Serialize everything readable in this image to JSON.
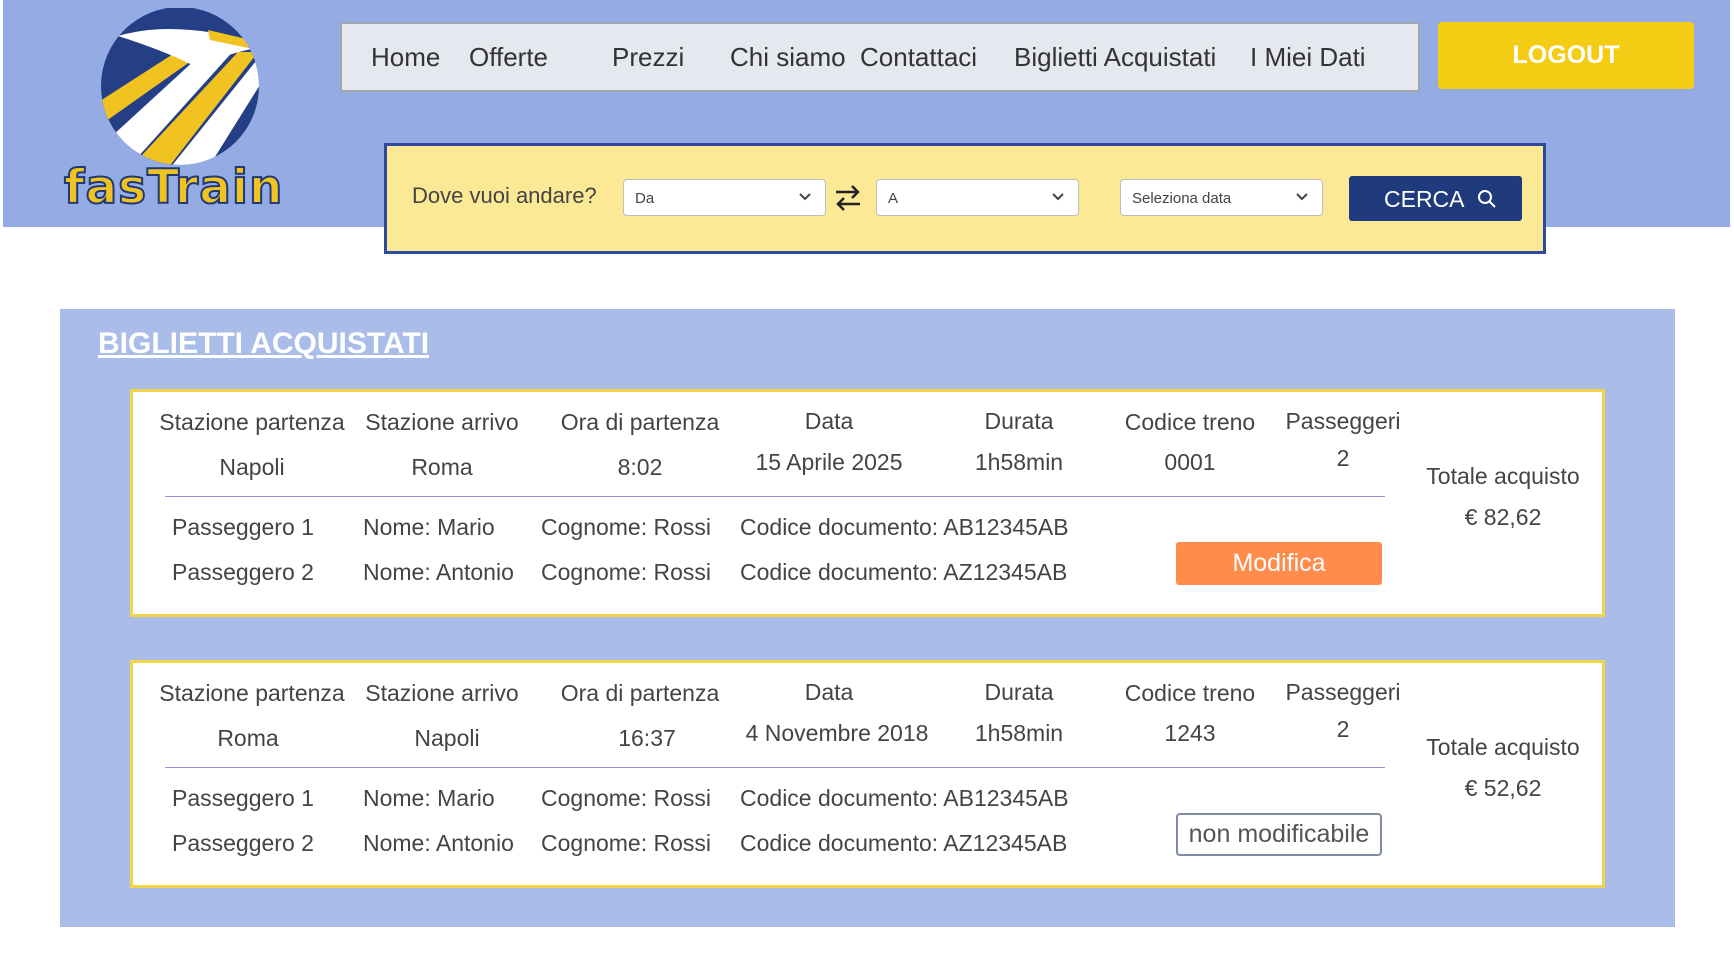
{
  "brand": {
    "name": "fasTrain",
    "colors": {
      "header_bg": "#94abe4",
      "accent": "#f5cc14",
      "navy": "#203a7e",
      "orange": "#ff8c4a"
    }
  },
  "nav": [
    "Home",
    "Offerte",
    "Prezzi",
    "Chi siamo",
    "Contattaci",
    "Biglietti Acquistati",
    "I Miei Dati"
  ],
  "logout_label": "LOGOUT",
  "search": {
    "label": "Dove vuoi andare?",
    "from_placeholder": "Da",
    "to_placeholder": "A",
    "date_placeholder": "Seleziona data",
    "button_label": "CERCA",
    "icons": [
      "chevron-down-icon",
      "swap-icon",
      "search-icon"
    ]
  },
  "section_title": "BIGLIETTI ACQUISTATI",
  "tickets": [
    {
      "headers": [
        "Stazione partenza",
        "Stazione arrivo",
        "Ora di partenza",
        "Data",
        "Durata",
        "Codice treno",
        "Passeggeri"
      ],
      "values": [
        "Napoli",
        "Roma",
        "8:02",
        "15 Aprile 2025",
        "1h58min",
        "0001",
        "2"
      ],
      "total_label": "Totale acquisto",
      "total_value": "€ 82,62",
      "passengers": [
        {
          "label": "Passeggero 1",
          "nome": "Nome: Mario",
          "cognome": "Cognome: Rossi",
          "documento": "Codice documento: AB12345AB"
        },
        {
          "label": "Passeggero 2",
          "nome": "Nome: Antonio",
          "cognome": "Cognome: Rossi",
          "documento": "Codice documento: AZ12345AB"
        }
      ],
      "action_label": "Modifica"
    },
    {
      "headers": [
        "Stazione partenza",
        "Stazione arrivo",
        "Ora di partenza",
        "Data",
        "Durata",
        "Codice treno",
        "Passeggeri"
      ],
      "values": [
        "Roma",
        "Napoli",
        "16:37",
        "4 Novembre 2018",
        "1h58min",
        "1243",
        "2"
      ],
      "total_label": "Totale acquisto",
      "total_value": "€ 52,62",
      "passengers": [
        {
          "label": "Passeggero 1",
          "nome": "Nome: Mario",
          "cognome": "Cognome: Rossi",
          "documento": "Codice documento: AB12345AB"
        },
        {
          "label": "Passeggero 2",
          "nome": "Nome: Antonio",
          "cognome": "Cognome: Rossi",
          "documento": "Codice documento: AZ12345AB"
        }
      ],
      "action_label": "non modificabile"
    }
  ]
}
